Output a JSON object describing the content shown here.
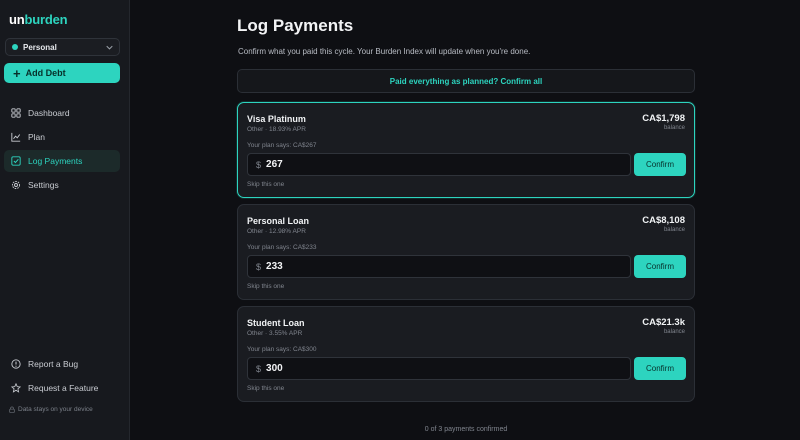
{
  "app": {
    "logo_part1": "un",
    "logo_part2": "burden"
  },
  "sidebar": {
    "profile": {
      "label": "Personal"
    },
    "add_debt_label": "Add Debt",
    "nav": {
      "dashboard": "Dashboard",
      "plan": "Plan",
      "log_payments": "Log Payments",
      "settings": "Settings"
    },
    "footer": {
      "report_bug": "Report a Bug",
      "request_feature": "Request a Feature",
      "device_note": "Data stays on your device"
    }
  },
  "page": {
    "title": "Log Payments",
    "subtitle": "Confirm what you paid this cycle. Your Burden Index will update when you're done.",
    "confirm_all": "Paid everything as planned? Confirm all",
    "footer_count": "0 of 3 payments confirmed"
  },
  "debts": [
    {
      "name": "Visa Platinum",
      "meta": "Other · 18.93% APR",
      "balance": "CA$1,798",
      "balance_label": "balance",
      "plan_says": "Your plan says: CA$267",
      "currency_symbol": "$",
      "amount": "267",
      "confirm_label": "Confirm",
      "skip_label": "Skip this one"
    },
    {
      "name": "Personal Loan",
      "meta": "Other · 12.98% APR",
      "balance": "CA$8,108",
      "balance_label": "balance",
      "plan_says": "Your plan says: CA$233",
      "currency_symbol": "$",
      "amount": "233",
      "confirm_label": "Confirm",
      "skip_label": "Skip this one"
    },
    {
      "name": "Student Loan",
      "meta": "Other · 3.55% APR",
      "balance": "CA$21.3k",
      "balance_label": "balance",
      "plan_says": "Your plan says: CA$300",
      "currency_symbol": "$",
      "amount": "300",
      "confirm_label": "Confirm",
      "skip_label": "Skip this one"
    }
  ],
  "colors": {
    "accent": "#2dd4bf",
    "background": "#0e0f13",
    "sidebar": "#17191e",
    "card": "#1a1c21"
  },
  "icons": {
    "dashboard": "grid-icon",
    "plan": "chart-line-icon",
    "log_payments": "checkbox-icon",
    "settings": "gear-icon",
    "report_bug": "info-circle-icon",
    "request_feature": "star-icon",
    "device_note": "lock-icon"
  }
}
